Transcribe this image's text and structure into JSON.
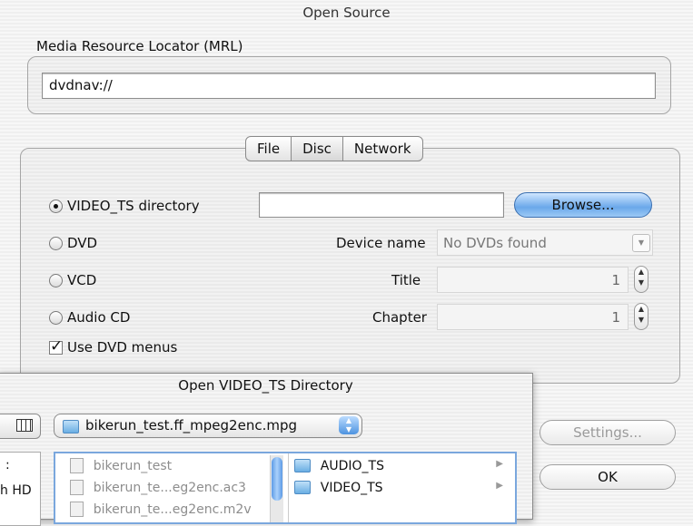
{
  "window": {
    "title": "Open Source"
  },
  "mrl": {
    "label": "Media Resource Locator (MRL)",
    "value": "dvdnav://"
  },
  "tabs": [
    {
      "label": "File"
    },
    {
      "label": "Disc"
    },
    {
      "label": "Network"
    }
  ],
  "disc": {
    "options": [
      {
        "label": "VIDEO_TS directory",
        "selected": true
      },
      {
        "label": "DVD",
        "selected": false
      },
      {
        "label": "VCD",
        "selected": false
      },
      {
        "label": "Audio CD",
        "selected": false
      }
    ],
    "browse_label": "Browse...",
    "device_name_label": "Device name",
    "device_name_value": "No DVDs found",
    "title_label": "Title",
    "title_value": "1",
    "chapter_label": "Chapter",
    "chapter_value": "1",
    "use_dvd_menus_label": "Use DVD menus",
    "use_dvd_menus_checked": true
  },
  "buttons": {
    "settings": "Settings...",
    "ok": "OK"
  },
  "sheet": {
    "title": "Open VIDEO_TS Directory",
    "location": "bikerun_test.ff_mpeg2enc.mpg",
    "left_fragments": [
      ":",
      "h HD"
    ],
    "files": [
      "bikerun_test",
      "bikerun_te...eg2enc.ac3",
      "bikerun_te...eg2enc.m2v"
    ],
    "folders": [
      "AUDIO_TS",
      "VIDEO_TS"
    ]
  },
  "colors": {
    "browse_blue": "#6aa8ea",
    "list_highlight": "#3875d7"
  }
}
